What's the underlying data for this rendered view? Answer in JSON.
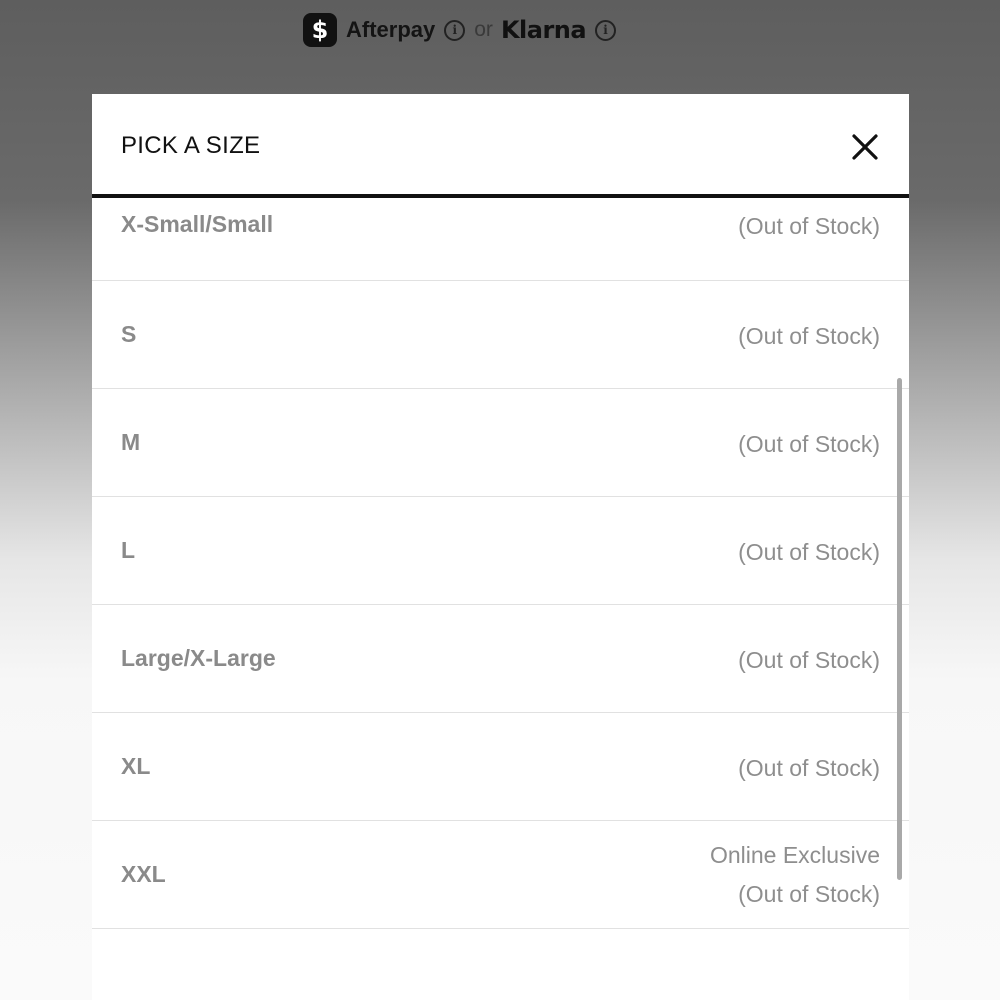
{
  "payment": {
    "cashapp_icon": "dollar-sign-icon",
    "cashapp_symbol": "$",
    "afterpay_label": "Afterpay",
    "info_symbol": "i",
    "or_label": "or",
    "klarna_label": "Klarna"
  },
  "dialog": {
    "title": "PICK A SIZE",
    "close_icon": "close-icon"
  },
  "sizes": [
    {
      "label": "X-Small/Small",
      "status": "(Out of Stock)"
    },
    {
      "label": "S",
      "status": "(Out of Stock)"
    },
    {
      "label": "M",
      "status": "(Out of Stock)"
    },
    {
      "label": "L",
      "status": "(Out of Stock)"
    },
    {
      "label": "Large/X-Large",
      "status": "(Out of Stock)"
    },
    {
      "label": "XL",
      "status": "(Out of Stock)"
    },
    {
      "label": "XXL",
      "note": "Online Exclusive",
      "status": "(Out of Stock)"
    }
  ],
  "colors": {
    "sheet_background": "#ffffff",
    "header_rule": "#111111",
    "disabled_text": "#8a8a8a"
  }
}
